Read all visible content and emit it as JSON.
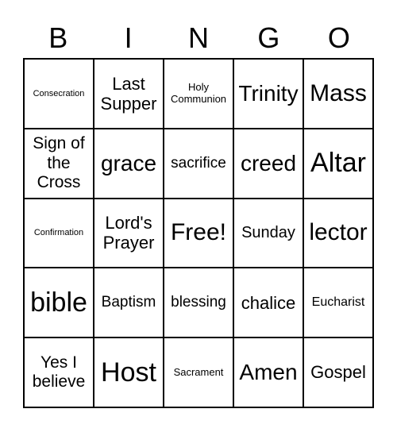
{
  "header": [
    "B",
    "I",
    "N",
    "G",
    "O"
  ],
  "cells": [
    "Consecration",
    "Last Supper",
    "Holy Communion",
    "Trinity",
    "Mass",
    "Sign of the Cross",
    "grace",
    "sacrifice",
    "creed",
    "Altar",
    "Confirmation",
    "Lord's Prayer",
    "Free!",
    "Sunday",
    "lector",
    "bible",
    "Baptism",
    "blessing",
    "chalice",
    "Eucharist",
    "Yes I believe",
    "Host",
    "Sacrament",
    "Amen",
    "Gospel"
  ]
}
